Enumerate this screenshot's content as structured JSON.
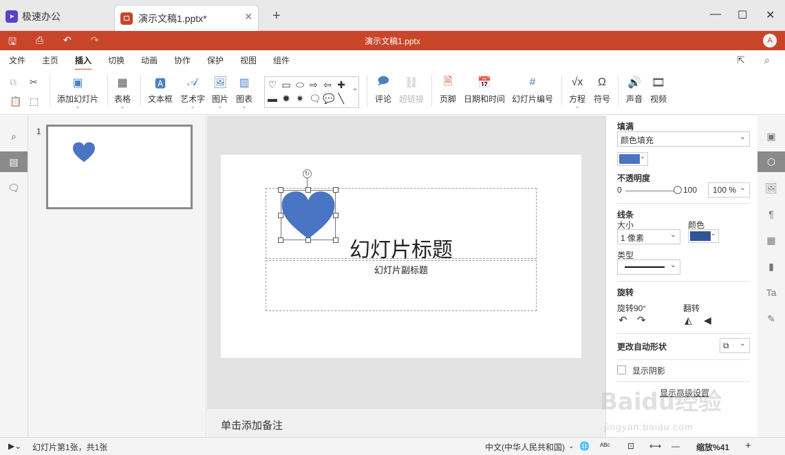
{
  "tabs": {
    "app_tab": "极速办公",
    "doc_tab": "演示文稿1.pptx*",
    "close_glyph": "✕",
    "add_glyph": "+"
  },
  "window": {
    "minimize": "—",
    "maximize": "☐",
    "close": "✕"
  },
  "titlebar": {
    "title": "演示文稿1.pptx",
    "avatar_letter": "A",
    "accent_color": "#c9452a"
  },
  "menu": {
    "items": [
      "文件",
      "主页",
      "插入",
      "切换",
      "动画",
      "协作",
      "保护",
      "视图",
      "组件"
    ],
    "active": "插入"
  },
  "toolbar": {
    "add_slide": "添加幻灯片",
    "table": "表格",
    "textbox": "文本框",
    "art_text": "艺术字",
    "image": "图片",
    "chart": "图表",
    "comment": "评论",
    "hyperlink": "超链接",
    "footer": "页脚",
    "datetime": "日期和时间",
    "slide_number": "幻灯片编号",
    "equation": "方程",
    "symbol": "符号",
    "audio": "声音",
    "video": "视频"
  },
  "thumbnails": {
    "slide_number": "1"
  },
  "slide": {
    "title": "幻灯片标题",
    "subtitle": "幻灯片副标题",
    "heart_color": "#4a74c4"
  },
  "notes": {
    "placeholder": "单击添加备注"
  },
  "properties": {
    "fill_label": "填满",
    "fill_type": "颜色填充",
    "fill_color": "#4a74c4",
    "opacity_label": "不透明度",
    "opacity_min": "0",
    "opacity_max": "100",
    "opacity_value": "100 %",
    "line_label": "线条",
    "size_label": "大小",
    "size_value": "1 像素",
    "color_label": "颜色",
    "line_color": "#2f5597",
    "type_label": "类型",
    "rotate_label": "旋转",
    "rotate90_label": "旋转90°",
    "flip_label": "翻转",
    "change_shape_label": "更改自动形状",
    "shadow_label": "显示阴影",
    "advanced_label": "显示高级设置"
  },
  "status": {
    "slide_info": "幻灯片第1张，共1张",
    "language": "中文(中华人民共和国)",
    "zoom": "缩放%41"
  },
  "watermark": {
    "text": "Baidu经验",
    "sub": "jingyan.baidu.com"
  }
}
